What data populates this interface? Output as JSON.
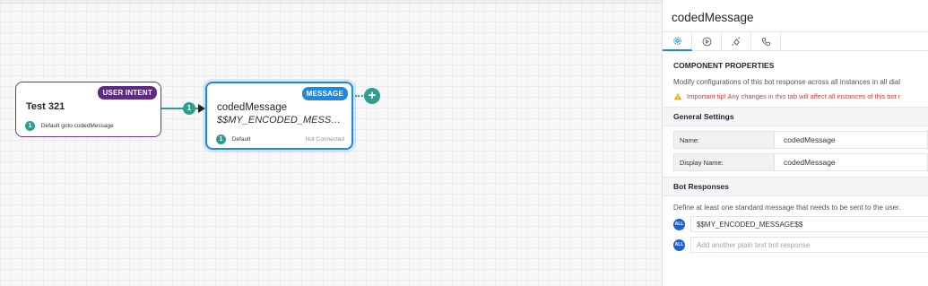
{
  "canvas": {
    "intent_node": {
      "title": "Test 321",
      "badge": "USER INTENT",
      "path_number": "1",
      "path_label": "Default goto codedMessage"
    },
    "connector": {
      "number": "1"
    },
    "message_node": {
      "title": "codedMessage",
      "subtitle": "$$MY_ENCODED_MESSAG...",
      "badge": "MESSAGE",
      "path_number": "1",
      "path_label": "Default",
      "status": "Not Connected"
    },
    "add_node_icon": "plus-icon"
  },
  "panel": {
    "title": "codedMessage",
    "tabs": [
      {
        "icon": "gear-icon",
        "active": true
      },
      {
        "icon": "play-circle-icon",
        "active": false
      },
      {
        "icon": "bug-icon",
        "active": false
      },
      {
        "icon": "phone-icon",
        "active": false
      }
    ],
    "component_properties": {
      "heading": "COMPONENT PROPERTIES",
      "description": "Modify configurations of this bot response across all instances in all dial",
      "tip": "Important tip! Any changes in this tab will affect all instances of this bot r"
    },
    "general_settings": {
      "heading": "General Settings",
      "name_label": "Name:",
      "name_value": "codedMessage",
      "display_name_label": "Display Name:",
      "display_name_value": "codedMessage"
    },
    "bot_responses": {
      "heading": "Bot Responses",
      "description": "Define at least one standard message that needs to be sent to the user.",
      "all_label": "ALL",
      "response_value": "$$MY_ENCODED_MESSAGE$$",
      "new_response_placeholder": "Add another plain text bot response"
    }
  },
  "colors": {
    "intent_border": "#6b3a8c",
    "intent_badge": "#5e2a84",
    "message_border": "#1e88e5",
    "connector": "#2e9e8f",
    "warning": "#d33a3a"
  }
}
